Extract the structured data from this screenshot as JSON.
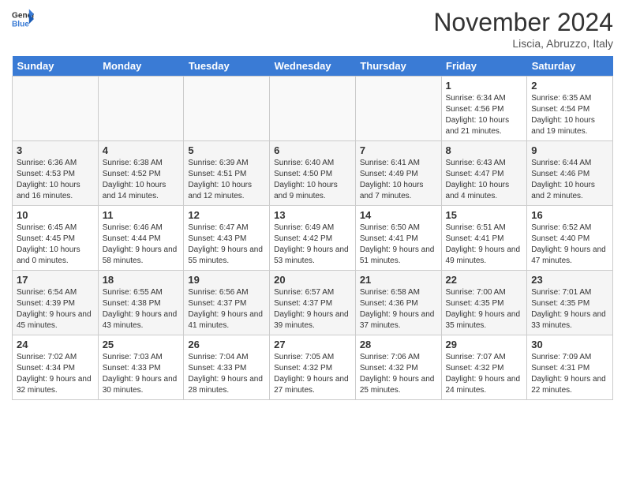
{
  "logo": {
    "text_general": "General",
    "text_blue": "Blue"
  },
  "header": {
    "month": "November 2024",
    "location": "Liscia, Abruzzo, Italy"
  },
  "days_of_week": [
    "Sunday",
    "Monday",
    "Tuesday",
    "Wednesday",
    "Thursday",
    "Friday",
    "Saturday"
  ],
  "weeks": [
    [
      {
        "day": "",
        "sunrise": "",
        "sunset": "",
        "daylight": "",
        "empty": true
      },
      {
        "day": "",
        "sunrise": "",
        "sunset": "",
        "daylight": "",
        "empty": true
      },
      {
        "day": "",
        "sunrise": "",
        "sunset": "",
        "daylight": "",
        "empty": true
      },
      {
        "day": "",
        "sunrise": "",
        "sunset": "",
        "daylight": "",
        "empty": true
      },
      {
        "day": "",
        "sunrise": "",
        "sunset": "",
        "daylight": "",
        "empty": true
      },
      {
        "day": "1",
        "sunrise": "Sunrise: 6:34 AM",
        "sunset": "Sunset: 4:56 PM",
        "daylight": "Daylight: 10 hours and 21 minutes.",
        "empty": false
      },
      {
        "day": "2",
        "sunrise": "Sunrise: 6:35 AM",
        "sunset": "Sunset: 4:54 PM",
        "daylight": "Daylight: 10 hours and 19 minutes.",
        "empty": false
      }
    ],
    [
      {
        "day": "3",
        "sunrise": "Sunrise: 6:36 AM",
        "sunset": "Sunset: 4:53 PM",
        "daylight": "Daylight: 10 hours and 16 minutes.",
        "empty": false
      },
      {
        "day": "4",
        "sunrise": "Sunrise: 6:38 AM",
        "sunset": "Sunset: 4:52 PM",
        "daylight": "Daylight: 10 hours and 14 minutes.",
        "empty": false
      },
      {
        "day": "5",
        "sunrise": "Sunrise: 6:39 AM",
        "sunset": "Sunset: 4:51 PM",
        "daylight": "Daylight: 10 hours and 12 minutes.",
        "empty": false
      },
      {
        "day": "6",
        "sunrise": "Sunrise: 6:40 AM",
        "sunset": "Sunset: 4:50 PM",
        "daylight": "Daylight: 10 hours and 9 minutes.",
        "empty": false
      },
      {
        "day": "7",
        "sunrise": "Sunrise: 6:41 AM",
        "sunset": "Sunset: 4:49 PM",
        "daylight": "Daylight: 10 hours and 7 minutes.",
        "empty": false
      },
      {
        "day": "8",
        "sunrise": "Sunrise: 6:43 AM",
        "sunset": "Sunset: 4:47 PM",
        "daylight": "Daylight: 10 hours and 4 minutes.",
        "empty": false
      },
      {
        "day": "9",
        "sunrise": "Sunrise: 6:44 AM",
        "sunset": "Sunset: 4:46 PM",
        "daylight": "Daylight: 10 hours and 2 minutes.",
        "empty": false
      }
    ],
    [
      {
        "day": "10",
        "sunrise": "Sunrise: 6:45 AM",
        "sunset": "Sunset: 4:45 PM",
        "daylight": "Daylight: 10 hours and 0 minutes.",
        "empty": false
      },
      {
        "day": "11",
        "sunrise": "Sunrise: 6:46 AM",
        "sunset": "Sunset: 4:44 PM",
        "daylight": "Daylight: 9 hours and 58 minutes.",
        "empty": false
      },
      {
        "day": "12",
        "sunrise": "Sunrise: 6:47 AM",
        "sunset": "Sunset: 4:43 PM",
        "daylight": "Daylight: 9 hours and 55 minutes.",
        "empty": false
      },
      {
        "day": "13",
        "sunrise": "Sunrise: 6:49 AM",
        "sunset": "Sunset: 4:42 PM",
        "daylight": "Daylight: 9 hours and 53 minutes.",
        "empty": false
      },
      {
        "day": "14",
        "sunrise": "Sunrise: 6:50 AM",
        "sunset": "Sunset: 4:41 PM",
        "daylight": "Daylight: 9 hours and 51 minutes.",
        "empty": false
      },
      {
        "day": "15",
        "sunrise": "Sunrise: 6:51 AM",
        "sunset": "Sunset: 4:41 PM",
        "daylight": "Daylight: 9 hours and 49 minutes.",
        "empty": false
      },
      {
        "day": "16",
        "sunrise": "Sunrise: 6:52 AM",
        "sunset": "Sunset: 4:40 PM",
        "daylight": "Daylight: 9 hours and 47 minutes.",
        "empty": false
      }
    ],
    [
      {
        "day": "17",
        "sunrise": "Sunrise: 6:54 AM",
        "sunset": "Sunset: 4:39 PM",
        "daylight": "Daylight: 9 hours and 45 minutes.",
        "empty": false
      },
      {
        "day": "18",
        "sunrise": "Sunrise: 6:55 AM",
        "sunset": "Sunset: 4:38 PM",
        "daylight": "Daylight: 9 hours and 43 minutes.",
        "empty": false
      },
      {
        "day": "19",
        "sunrise": "Sunrise: 6:56 AM",
        "sunset": "Sunset: 4:37 PM",
        "daylight": "Daylight: 9 hours and 41 minutes.",
        "empty": false
      },
      {
        "day": "20",
        "sunrise": "Sunrise: 6:57 AM",
        "sunset": "Sunset: 4:37 PM",
        "daylight": "Daylight: 9 hours and 39 minutes.",
        "empty": false
      },
      {
        "day": "21",
        "sunrise": "Sunrise: 6:58 AM",
        "sunset": "Sunset: 4:36 PM",
        "daylight": "Daylight: 9 hours and 37 minutes.",
        "empty": false
      },
      {
        "day": "22",
        "sunrise": "Sunrise: 7:00 AM",
        "sunset": "Sunset: 4:35 PM",
        "daylight": "Daylight: 9 hours and 35 minutes.",
        "empty": false
      },
      {
        "day": "23",
        "sunrise": "Sunrise: 7:01 AM",
        "sunset": "Sunset: 4:35 PM",
        "daylight": "Daylight: 9 hours and 33 minutes.",
        "empty": false
      }
    ],
    [
      {
        "day": "24",
        "sunrise": "Sunrise: 7:02 AM",
        "sunset": "Sunset: 4:34 PM",
        "daylight": "Daylight: 9 hours and 32 minutes.",
        "empty": false
      },
      {
        "day": "25",
        "sunrise": "Sunrise: 7:03 AM",
        "sunset": "Sunset: 4:33 PM",
        "daylight": "Daylight: 9 hours and 30 minutes.",
        "empty": false
      },
      {
        "day": "26",
        "sunrise": "Sunrise: 7:04 AM",
        "sunset": "Sunset: 4:33 PM",
        "daylight": "Daylight: 9 hours and 28 minutes.",
        "empty": false
      },
      {
        "day": "27",
        "sunrise": "Sunrise: 7:05 AM",
        "sunset": "Sunset: 4:32 PM",
        "daylight": "Daylight: 9 hours and 27 minutes.",
        "empty": false
      },
      {
        "day": "28",
        "sunrise": "Sunrise: 7:06 AM",
        "sunset": "Sunset: 4:32 PM",
        "daylight": "Daylight: 9 hours and 25 minutes.",
        "empty": false
      },
      {
        "day": "29",
        "sunrise": "Sunrise: 7:07 AM",
        "sunset": "Sunset: 4:32 PM",
        "daylight": "Daylight: 9 hours and 24 minutes.",
        "empty": false
      },
      {
        "day": "30",
        "sunrise": "Sunrise: 7:09 AM",
        "sunset": "Sunset: 4:31 PM",
        "daylight": "Daylight: 9 hours and 22 minutes.",
        "empty": false
      }
    ]
  ]
}
